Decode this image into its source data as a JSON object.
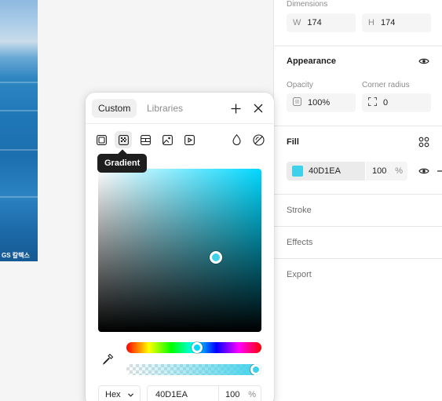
{
  "colors": {
    "accent": "#40D1EA",
    "tooltip_bg": "#1e1e1e",
    "panel_bg": "#ffffff"
  },
  "canvas": {
    "logo_text": "GS 칼텍스"
  },
  "dimensions": {
    "label": "Dimensions",
    "w_prefix": "W",
    "w_value": "174",
    "h_prefix": "H",
    "h_value": "174"
  },
  "appearance": {
    "title": "Appearance",
    "opacity_label": "Opacity",
    "opacity_value": "100%",
    "corner_label": "Corner radius",
    "corner_value": "0"
  },
  "fill": {
    "title": "Fill",
    "hex": "40D1EA",
    "opacity": "100",
    "percent": "%"
  },
  "sections": {
    "stroke": "Stroke",
    "effects": "Effects",
    "export": "Export"
  },
  "picker": {
    "tabs": [
      {
        "label": "Custom"
      },
      {
        "label": "Libraries"
      }
    ],
    "tools": [
      "solid-fill-icon",
      "gradient-icon",
      "pattern-icon",
      "image-icon",
      "video-icon"
    ],
    "tooltip": "Gradient",
    "mode": "Hex",
    "hex": "40D1EA",
    "opacity": "100",
    "percent": "%"
  }
}
